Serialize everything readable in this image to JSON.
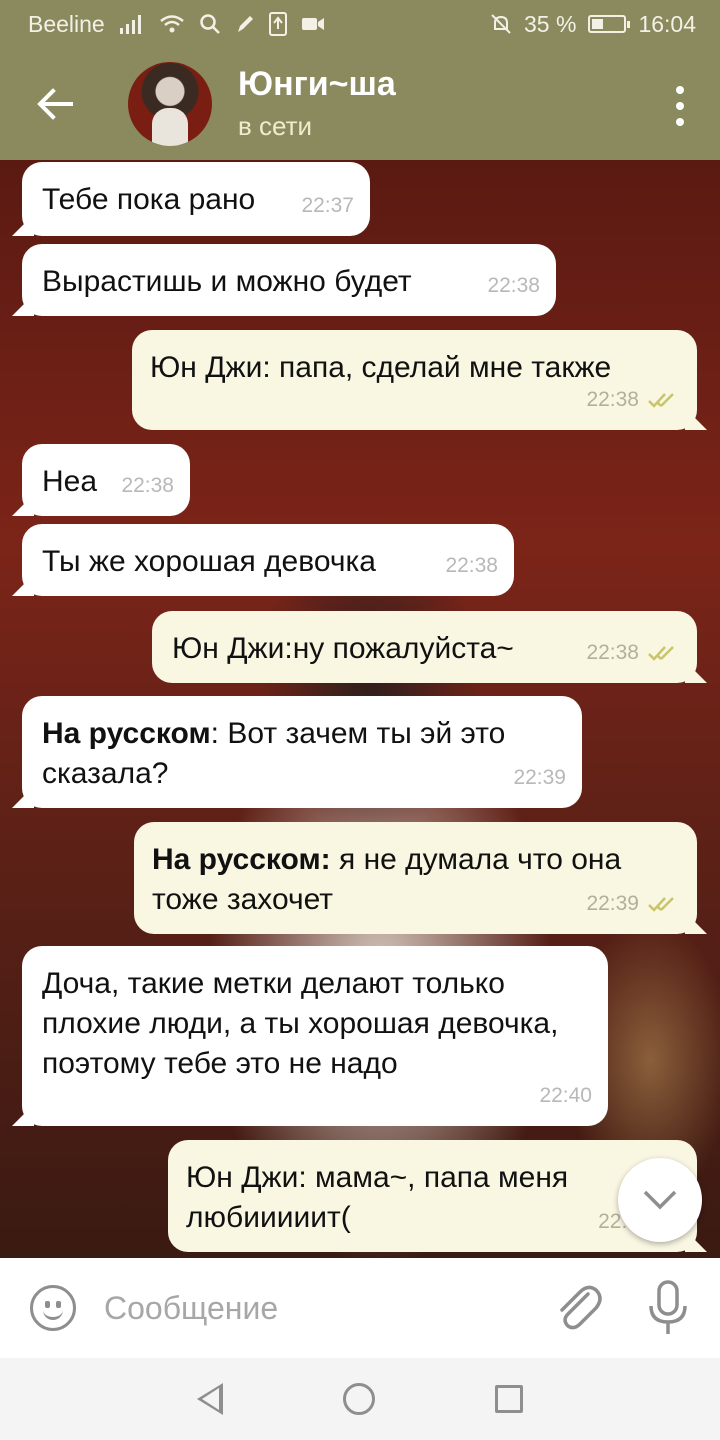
{
  "status_bar": {
    "carrier": "Beeline",
    "battery_text": "35 %",
    "battery_level": 0.35,
    "time": "16:04",
    "icons": [
      "signal-icon",
      "wifi-icon",
      "search-icon",
      "pen-icon",
      "upload-icon",
      "video-icon",
      "mute-bell-icon",
      "battery-icon"
    ]
  },
  "header": {
    "title": "Юнги~ша",
    "status": "в сети",
    "colors": {
      "bar": "#8b8a5f"
    }
  },
  "messages": [
    {
      "dir": "in",
      "text": "Тебе пока рано",
      "time": "22:37"
    },
    {
      "dir": "in",
      "text": "Вырастишь и можно будет",
      "time": "22:38"
    },
    {
      "dir": "out",
      "text": "Юн Джи: папа, сделай мне также",
      "time": "22:38",
      "read": true
    },
    {
      "dir": "in",
      "text": "Неа",
      "time": "22:38"
    },
    {
      "dir": "in",
      "text": "Ты же хорошая девочка",
      "time": "22:38"
    },
    {
      "dir": "out",
      "text": "Юн Джи:ну пожалуйста~",
      "time": "22:38",
      "read": true
    },
    {
      "dir": "in",
      "bold": "На русском",
      "text": ": Вот зачем ты эй это сказала?",
      "time": "22:39"
    },
    {
      "dir": "out",
      "bold": "На русском:",
      "text": " я не думала что она тоже захочет",
      "time": "22:39",
      "read": true
    },
    {
      "dir": "in",
      "text": "Доча, такие метки делают только плохие люди, а ты хорошая девочка, поэтому тебе это не надо",
      "time": "22:40"
    },
    {
      "dir": "out",
      "text": "Юн Джи: мама~, папа меня любииииит(",
      "time": "22:4",
      "read": true
    }
  ],
  "input": {
    "placeholder": "Сообщение"
  }
}
